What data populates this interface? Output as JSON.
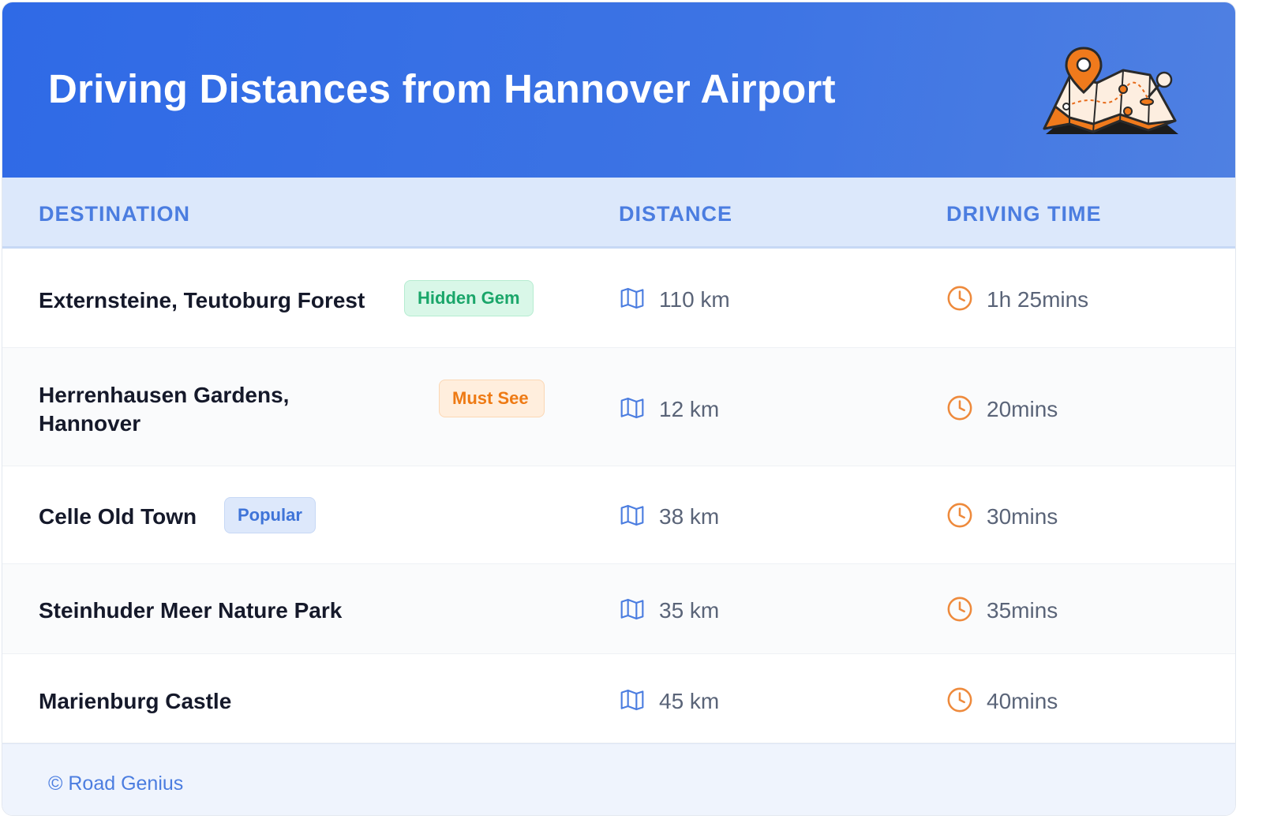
{
  "header": {
    "title": "Driving Distances from Hannover Airport"
  },
  "columns": {
    "destination": "DESTINATION",
    "distance": "DISTANCE",
    "time": "DRIVING TIME"
  },
  "rows": [
    {
      "destination": "Externsteine, Teutoburg Forest",
      "badge": "Hidden Gem",
      "distance": "110 km",
      "time": "1h 25mins"
    },
    {
      "destination": "Herrenhausen Gardens, Hannover",
      "badge": "Must See",
      "distance": "12 km",
      "time": "20mins"
    },
    {
      "destination": "Celle Old Town",
      "badge": "Popular",
      "distance": "38 km",
      "time": "30mins"
    },
    {
      "destination": "Steinhuder Meer Nature Park",
      "badge": "",
      "distance": "35 km",
      "time": "35mins"
    },
    {
      "destination": "Marienburg Castle",
      "badge": "",
      "distance": "45 km",
      "time": "40mins"
    }
  ],
  "footer": {
    "credit": "© Road Genius"
  },
  "colors": {
    "header_blue": "#2f6ae6",
    "accent_blue": "#4b7de0",
    "clock_orange": "#ee8a3c",
    "badge_green": "#1aa66a",
    "badge_orange": "#ee7a14"
  },
  "icons": {
    "distance": "map-icon",
    "time": "clock-icon",
    "header": "map-pin-illustration-icon"
  }
}
